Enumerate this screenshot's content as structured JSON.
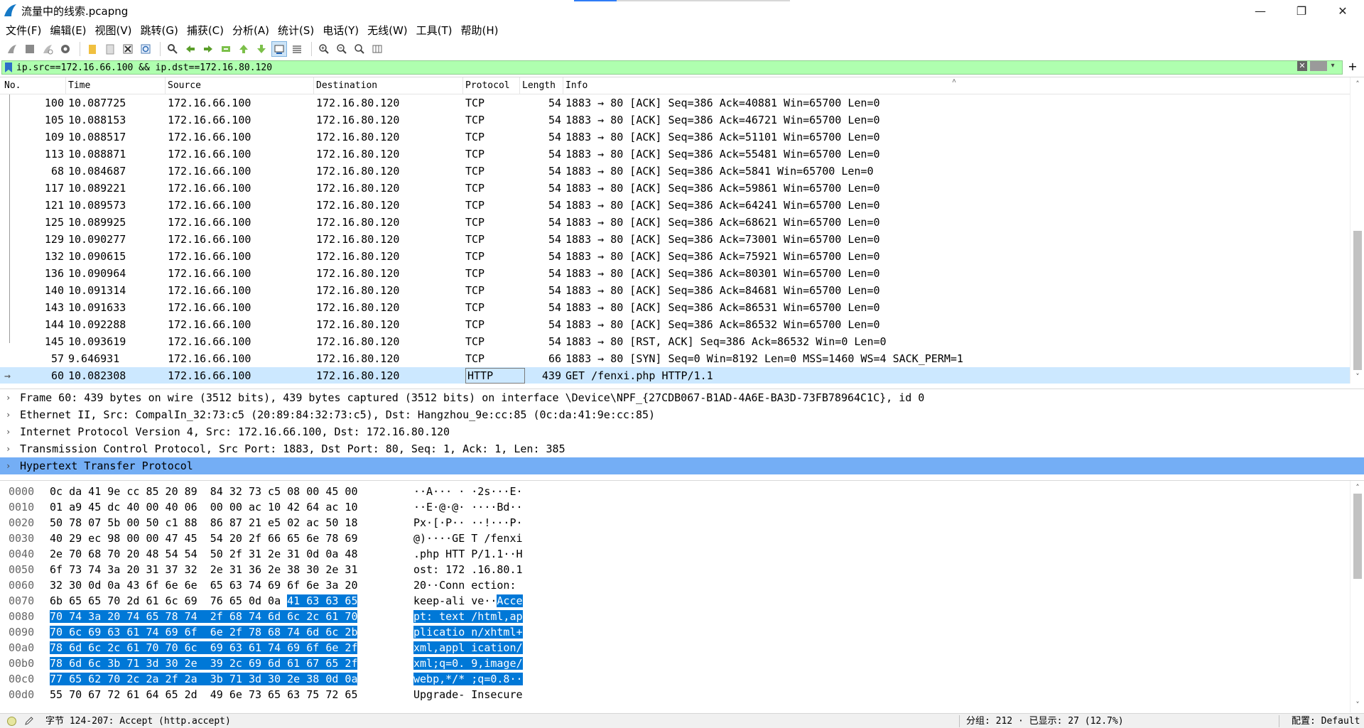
{
  "window": {
    "title": "流量中的线索.pcapng",
    "minimize": "—",
    "maximize": "❐",
    "close": "✕"
  },
  "menu": [
    "文件(F)",
    "编辑(E)",
    "视图(V)",
    "跳转(G)",
    "捕获(C)",
    "分析(A)",
    "统计(S)",
    "电话(Y)",
    "无线(W)",
    "工具(T)",
    "帮助(H)"
  ],
  "filter": {
    "value": "ip.src==172.16.66.100 && ip.dst==172.16.80.120",
    "bg_color": "#afffaf"
  },
  "packet_list": {
    "columns": [
      "No.",
      "Time",
      "Source",
      "Destination",
      "Protocol",
      "Length",
      "Info"
    ],
    "rows": [
      {
        "no": "100",
        "time": "10.087725",
        "src": "172.16.66.100",
        "dst": "172.16.80.120",
        "proto": "TCP",
        "len": "54",
        "info": "1883 → 80 [ACK] Seq=386 Ack=40881 Win=65700 Len=0"
      },
      {
        "no": "105",
        "time": "10.088153",
        "src": "172.16.66.100",
        "dst": "172.16.80.120",
        "proto": "TCP",
        "len": "54",
        "info": "1883 → 80 [ACK] Seq=386 Ack=46721 Win=65700 Len=0"
      },
      {
        "no": "109",
        "time": "10.088517",
        "src": "172.16.66.100",
        "dst": "172.16.80.120",
        "proto": "TCP",
        "len": "54",
        "info": "1883 → 80 [ACK] Seq=386 Ack=51101 Win=65700 Len=0"
      },
      {
        "no": "113",
        "time": "10.088871",
        "src": "172.16.66.100",
        "dst": "172.16.80.120",
        "proto": "TCP",
        "len": "54",
        "info": "1883 → 80 [ACK] Seq=386 Ack=55481 Win=65700 Len=0"
      },
      {
        "no": "68",
        "time": "10.084687",
        "src": "172.16.66.100",
        "dst": "172.16.80.120",
        "proto": "TCP",
        "len": "54",
        "info": "1883 → 80 [ACK] Seq=386 Ack=5841 Win=65700 Len=0"
      },
      {
        "no": "117",
        "time": "10.089221",
        "src": "172.16.66.100",
        "dst": "172.16.80.120",
        "proto": "TCP",
        "len": "54",
        "info": "1883 → 80 [ACK] Seq=386 Ack=59861 Win=65700 Len=0"
      },
      {
        "no": "121",
        "time": "10.089573",
        "src": "172.16.66.100",
        "dst": "172.16.80.120",
        "proto": "TCP",
        "len": "54",
        "info": "1883 → 80 [ACK] Seq=386 Ack=64241 Win=65700 Len=0"
      },
      {
        "no": "125",
        "time": "10.089925",
        "src": "172.16.66.100",
        "dst": "172.16.80.120",
        "proto": "TCP",
        "len": "54",
        "info": "1883 → 80 [ACK] Seq=386 Ack=68621 Win=65700 Len=0"
      },
      {
        "no": "129",
        "time": "10.090277",
        "src": "172.16.66.100",
        "dst": "172.16.80.120",
        "proto": "TCP",
        "len": "54",
        "info": "1883 → 80 [ACK] Seq=386 Ack=73001 Win=65700 Len=0"
      },
      {
        "no": "132",
        "time": "10.090615",
        "src": "172.16.66.100",
        "dst": "172.16.80.120",
        "proto": "TCP",
        "len": "54",
        "info": "1883 → 80 [ACK] Seq=386 Ack=75921 Win=65700 Len=0"
      },
      {
        "no": "136",
        "time": "10.090964",
        "src": "172.16.66.100",
        "dst": "172.16.80.120",
        "proto": "TCP",
        "len": "54",
        "info": "1883 → 80 [ACK] Seq=386 Ack=80301 Win=65700 Len=0"
      },
      {
        "no": "140",
        "time": "10.091314",
        "src": "172.16.66.100",
        "dst": "172.16.80.120",
        "proto": "TCP",
        "len": "54",
        "info": "1883 → 80 [ACK] Seq=386 Ack=84681 Win=65700 Len=0"
      },
      {
        "no": "143",
        "time": "10.091633",
        "src": "172.16.66.100",
        "dst": "172.16.80.120",
        "proto": "TCP",
        "len": "54",
        "info": "1883 → 80 [ACK] Seq=386 Ack=86531 Win=65700 Len=0"
      },
      {
        "no": "144",
        "time": "10.092288",
        "src": "172.16.66.100",
        "dst": "172.16.80.120",
        "proto": "TCP",
        "len": "54",
        "info": "1883 → 80 [ACK] Seq=386 Ack=86532 Win=65700 Len=0"
      },
      {
        "no": "145",
        "time": "10.093619",
        "src": "172.16.66.100",
        "dst": "172.16.80.120",
        "proto": "TCP",
        "len": "54",
        "info": "1883 → 80 [RST, ACK] Seq=386 Ack=86532 Win=0 Len=0"
      },
      {
        "no": "57",
        "time": "9.646931",
        "src": "172.16.66.100",
        "dst": "172.16.80.120",
        "proto": "TCP",
        "len": "66",
        "info": "1883 → 80 [SYN] Seq=0 Win=8192 Len=0 MSS=1460 WS=4 SACK_PERM=1"
      },
      {
        "no": "60",
        "time": "10.082308",
        "src": "172.16.66.100",
        "dst": "172.16.80.120",
        "proto": "HTTP",
        "len": "439",
        "info": "GET /fenxi.php HTTP/1.1",
        "selected": true
      }
    ]
  },
  "details": [
    {
      "text": "Frame 60: 439 bytes on wire (3512 bits), 439 bytes captured (3512 bits) on interface \\Device\\NPF_{27CDB067-B1AD-4A6E-BA3D-73FB78964C1C}, id 0"
    },
    {
      "text": "Ethernet II, Src: CompalIn_32:73:c5 (20:89:84:32:73:c5), Dst: Hangzhou_9e:cc:85 (0c:da:41:9e:cc:85)"
    },
    {
      "text": "Internet Protocol Version 4, Src: 172.16.66.100, Dst: 172.16.80.120"
    },
    {
      "text": "Transmission Control Protocol, Src Port: 1883, Dst Port: 80, Seq: 1, Ack: 1, Len: 385"
    },
    {
      "text": "Hypertext Transfer Protocol",
      "selected": true
    }
  ],
  "bytes": [
    {
      "off": "0000",
      "hex": [
        [
          "0c da 41 9e cc 85 20 89  84 32 73 c5 08 00 45 00",
          ""
        ]
      ],
      "asc": [
        [
          "··A··· · ·2s···E·",
          ""
        ]
      ]
    },
    {
      "off": "0010",
      "hex": [
        [
          "01 a9 45 dc 40 00 40 06  00 00 ac 10 42 64 ac 10",
          ""
        ]
      ],
      "asc": [
        [
          "··E·@·@· ····Bd··",
          ""
        ]
      ]
    },
    {
      "off": "0020",
      "hex": [
        [
          "50 78 07 5b 00 50 c1 88  86 87 21 e5 02 ac 50 18",
          ""
        ]
      ],
      "asc": [
        [
          "Px·[·P·· ··!···P·",
          ""
        ]
      ]
    },
    {
      "off": "0030",
      "hex": [
        [
          "40 29 ec 98 00 00 47 45  54 20 2f 66 65 6e 78 69",
          ""
        ]
      ],
      "asc": [
        [
          "@)····GE T /fenxi",
          ""
        ]
      ]
    },
    {
      "off": "0040",
      "hex": [
        [
          "2e 70 68 70 20 48 54 54  50 2f 31 2e 31 0d 0a 48",
          ""
        ]
      ],
      "asc": [
        [
          ".php HTT P/1.1··H",
          ""
        ]
      ]
    },
    {
      "off": "0050",
      "hex": [
        [
          "6f 73 74 3a 20 31 37 32  2e 31 36 2e 38 30 2e 31",
          ""
        ]
      ],
      "asc": [
        [
          "ost: 172 .16.80.1",
          ""
        ]
      ]
    },
    {
      "off": "0060",
      "hex": [
        [
          "32 30 0d 0a 43 6f 6e 6e  65 63 74 69 6f 6e 3a 20",
          ""
        ]
      ],
      "asc": [
        [
          "20··Conn ection: ",
          ""
        ]
      ]
    },
    {
      "off": "0070",
      "hex": [
        [
          "6b 65 65 70 2d 61 6c 69  76 65 0d 0a ",
          ""
        ],
        [
          "41 63 63 65",
          "hl"
        ]
      ],
      "asc": [
        [
          "keep-ali ve··",
          ""
        ],
        [
          "Acce",
          "hl"
        ]
      ]
    },
    {
      "off": "0080",
      "hex": [
        [
          "70 74 3a 20 74 65 78 74  2f 68 74 6d 6c 2c 61 70",
          "hl"
        ]
      ],
      "asc": [
        [
          "pt: text /html,ap",
          "hl"
        ]
      ]
    },
    {
      "off": "0090",
      "hex": [
        [
          "70 6c 69 63 61 74 69 6f  6e 2f 78 68 74 6d 6c 2b",
          "hl"
        ]
      ],
      "asc": [
        [
          "plicatio n/xhtml+",
          "hl"
        ]
      ]
    },
    {
      "off": "00a0",
      "hex": [
        [
          "78 6d 6c 2c 61 70 70 6c  69 63 61 74 69 6f 6e 2f",
          "hl"
        ]
      ],
      "asc": [
        [
          "xml,appl ication/",
          "hl"
        ]
      ]
    },
    {
      "off": "00b0",
      "hex": [
        [
          "78 6d 6c 3b 71 3d 30 2e  39 2c 69 6d 61 67 65 2f",
          "hl"
        ]
      ],
      "asc": [
        [
          "xml;q=0. 9,image/",
          "hl"
        ]
      ]
    },
    {
      "off": "00c0",
      "hex": [
        [
          "77 65 62 70 2c 2a 2f 2a  3b 71 3d 30 2e 38 0d 0a",
          "hl"
        ]
      ],
      "asc": [
        [
          "webp,*/* ;q=0.8··",
          "hl"
        ]
      ]
    },
    {
      "off": "00d0",
      "hex": [
        [
          "55 70 67 72 61 64 65 2d  49 6e 73 65 63 75 72 65",
          ""
        ]
      ],
      "asc": [
        [
          "Upgrade- Insecure",
          ""
        ]
      ]
    }
  ],
  "status": {
    "field": "字节 124-207: Accept (http.accept)",
    "packets": "分组: 212 · 已显示: 27 (12.7%)",
    "profile": "配置: Default"
  },
  "colors": {
    "selected_row": "#cce8ff",
    "selected_detail": "#74aef5",
    "byte_highlight": "#0078d7"
  }
}
